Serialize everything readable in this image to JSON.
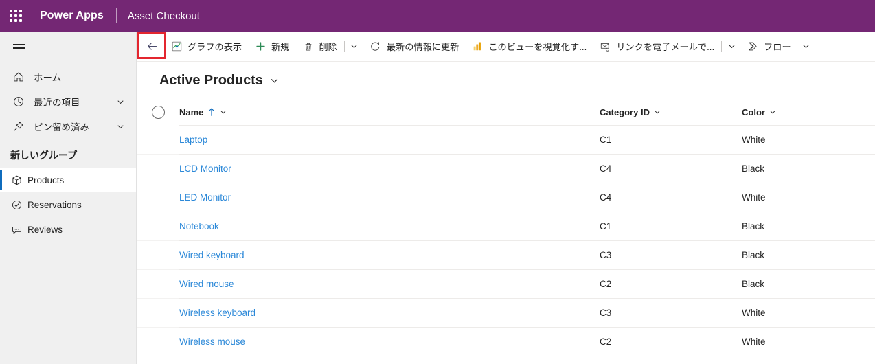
{
  "topbar": {
    "waffle_icon": "app-launcher-icon",
    "brand": "Power Apps",
    "app_name": "Asset Checkout"
  },
  "sidebar": {
    "hamburger_icon": "hamburger-menu-icon",
    "items": [
      {
        "label": "ホーム",
        "icon": "home-icon",
        "has_chevron": false
      },
      {
        "label": "最近の項目",
        "icon": "clock-icon",
        "has_chevron": true
      },
      {
        "label": "ピン留め済み",
        "icon": "pin-icon",
        "has_chevron": true
      }
    ],
    "group_title": "新しいグループ",
    "entities": [
      {
        "label": "Products",
        "icon": "box-icon",
        "selected": true
      },
      {
        "label": "Reservations",
        "icon": "check-circle-icon",
        "selected": false
      },
      {
        "label": "Reviews",
        "icon": "comment-icon",
        "selected": false
      }
    ]
  },
  "commandbar": {
    "back_label": "戻る",
    "back_icon": "back-arrow-icon",
    "items": [
      {
        "label": "グラフの表示",
        "icon": "show-chart-icon"
      },
      {
        "label": "新規",
        "icon": "plus-icon"
      },
      {
        "label": "削除",
        "icon": "trash-icon"
      },
      {
        "label": "最新の情報に更新",
        "icon": "refresh-icon"
      },
      {
        "label": "このビューを視覚化す...",
        "icon": "powerbi-icon"
      },
      {
        "label": "リンクを電子メールで...",
        "icon": "email-link-icon"
      },
      {
        "label": "フロー",
        "icon": "flow-icon"
      }
    ],
    "caret_icon": "chevron-down-icon"
  },
  "view": {
    "title": "Active Products",
    "title_caret_icon": "chevron-down-icon"
  },
  "grid": {
    "select_all_icon": "select-all-circle",
    "columns": [
      {
        "label": "Name",
        "sorted": "asc",
        "sort_icon": "arrow-up-icon"
      },
      {
        "label": "Category ID",
        "sorted": "none"
      },
      {
        "label": "Color",
        "sorted": "none"
      }
    ],
    "rows": [
      {
        "name": "Laptop",
        "category_id": "C1",
        "color": "White"
      },
      {
        "name": "LCD Monitor",
        "category_id": "C4",
        "color": "Black"
      },
      {
        "name": "LED Monitor",
        "category_id": "C4",
        "color": "White"
      },
      {
        "name": "Notebook",
        "category_id": "C1",
        "color": "Black"
      },
      {
        "name": "Wired keyboard",
        "category_id": "C3",
        "color": "Black"
      },
      {
        "name": "Wired mouse",
        "category_id": "C2",
        "color": "Black"
      },
      {
        "name": "Wireless keyboard",
        "category_id": "C3",
        "color": "White"
      },
      {
        "name": "Wireless mouse",
        "category_id": "C2",
        "color": "White"
      }
    ]
  },
  "annotation": {
    "highlight_color": "#e3262f",
    "target": "back-button"
  },
  "colors": {
    "brand_purple": "#742774",
    "link_blue": "#2b88d8",
    "selection_blue": "#0f6cbd",
    "sidebar_bg": "#f0f0f0"
  }
}
